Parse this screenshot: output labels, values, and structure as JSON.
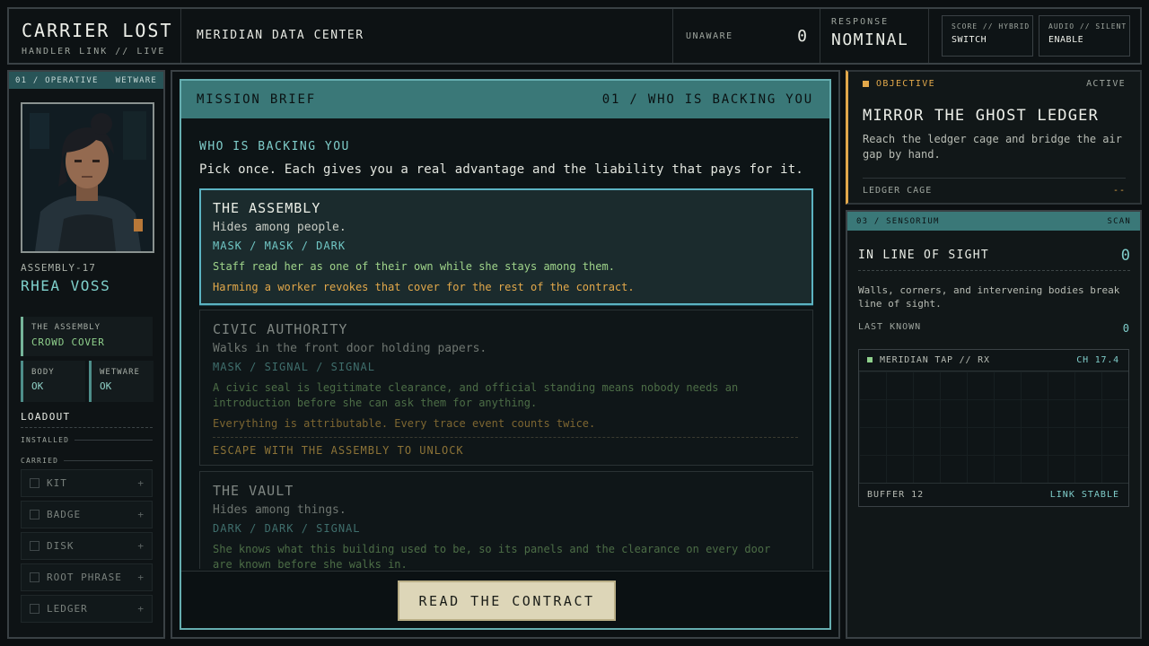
{
  "header": {
    "title": "CARRIER LOST",
    "subtitle": "HANDLER LINK // LIVE",
    "location": "MERIDIAN DATA CENTER",
    "alert_label": "UNAWARE",
    "alert_value": "0",
    "response_label": "RESPONSE",
    "response_value": "NOMINAL",
    "toggles": [
      {
        "label": "SCORE // HYBRID",
        "action": "SWITCH"
      },
      {
        "label": "AUDIO // SILENT",
        "action": "ENABLE"
      }
    ]
  },
  "operative": {
    "panel_label": "01 / OPERATIVE",
    "panel_tag": "WETWARE",
    "codename": "ASSEMBLY-17",
    "name": "RHEA VOSS",
    "faction_label": "THE ASSEMBLY",
    "faction_value": "CROWD COVER",
    "stats": [
      {
        "label": "BODY",
        "value": "OK"
      },
      {
        "label": "WETWARE",
        "value": "OK"
      }
    ],
    "loadout_title": "LOADOUT",
    "installed_label": "INSTALLED",
    "carried_label": "CARRIED",
    "slots": [
      "KIT",
      "BADGE",
      "DISK",
      "ROOT PHRASE",
      "LEDGER"
    ],
    "slot_plus": "+"
  },
  "mission": {
    "header_left": "MISSION BRIEF",
    "header_right": "01 / WHO IS BACKING YOU",
    "section_title": "WHO IS BACKING YOU",
    "intro": "Pick once. Each gives you a real advantage and the liability that pays for it.",
    "choices": [
      {
        "name": "THE ASSEMBLY",
        "desc": "Hides among people.",
        "tags": "MASK / MASK / DARK",
        "advantage": "Staff read her as one of their own while she stays among them.",
        "cost": "Harming a worker revokes that cover for the rest of the contract.",
        "unlock": ""
      },
      {
        "name": "CIVIC AUTHORITY",
        "desc": "Walks in the front door holding papers.",
        "tags": "MASK / SIGNAL / SIGNAL",
        "advantage": "A civic seal is legitimate clearance, and official standing means nobody needs an introduction before she can ask them for anything.",
        "cost": "Everything is attributable. Every trace event counts twice.",
        "unlock": "ESCAPE WITH THE ASSEMBLY TO UNLOCK"
      },
      {
        "name": "THE VAULT",
        "desc": "Hides among things.",
        "tags": "DARK / DARK / SIGNAL",
        "advantage": "She knows what this building used to be, so its panels and the clearance on every door are known before she walks in.",
        "cost": "",
        "unlock": ""
      }
    ],
    "cta": "READ THE CONTRACT"
  },
  "objective": {
    "tag": "OBJECTIVE",
    "status": "ACTIVE",
    "title": "MIRROR THE GHOST LEDGER",
    "desc": "Reach the ledger cage and bridge the air gap by hand.",
    "foot_label": "LEDGER CAGE",
    "foot_value": "--"
  },
  "sensorium": {
    "panel_label": "03 / SENSORIUM",
    "panel_tag": "SCAN",
    "los_label": "IN LINE OF SIGHT",
    "los_value": "0",
    "desc": "Walls, corners, and intervening bodies break line of sight.",
    "last_known_label": "LAST KNOWN",
    "last_known_value": "0",
    "feed_label": "MERIDIAN TAP // RX",
    "feed_channel": "CH 17.4",
    "buffer": "BUFFER 12",
    "link_status": "LINK STABLE"
  },
  "colors": {
    "accent_teal": "#3a7878",
    "accent_amber": "#e2a84a",
    "accent_green": "#8fd08c",
    "cta_bg": "#ddd6b8"
  }
}
